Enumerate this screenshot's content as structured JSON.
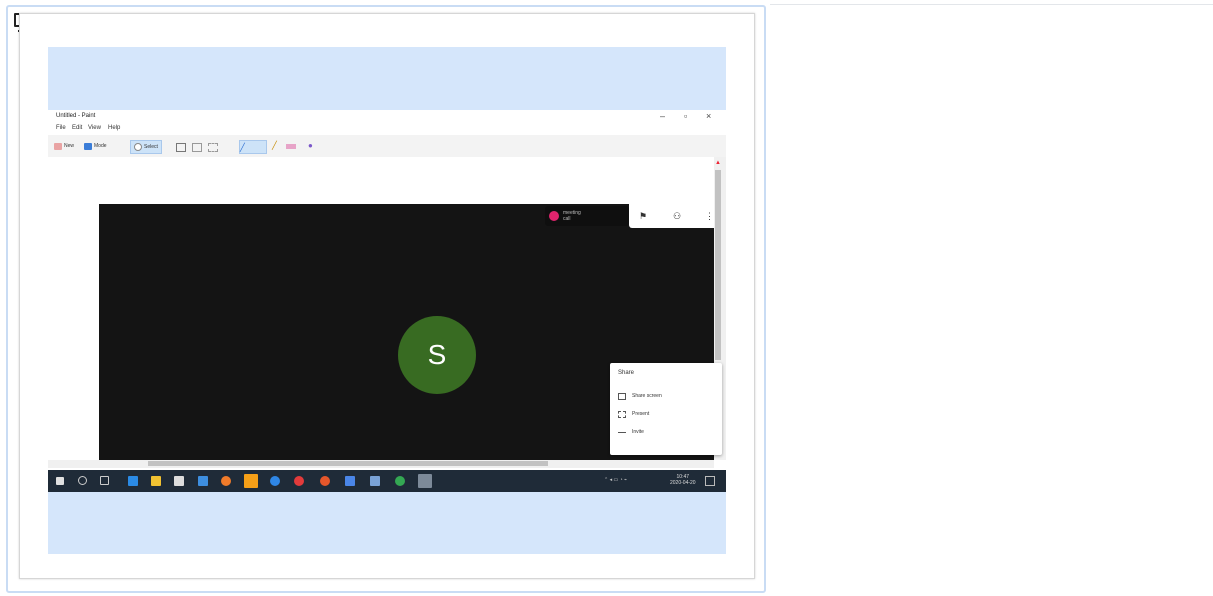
{
  "colors": {
    "accent_border": "#c9dcf4",
    "panel_bg": "#d5e6fb",
    "avatar_bg": "#386b22",
    "taskbar_bg": "#1f2b38"
  },
  "attachment_icon": "monitor-icon",
  "paint": {
    "title": "Untitled - Paint",
    "menu": [
      "File",
      "Edit",
      "View",
      "Help"
    ],
    "toolbar": {
      "new": "New",
      "mode": "Mode",
      "select": "Select"
    }
  },
  "call": {
    "avatar_letter": "S",
    "brand_line1": "meeting",
    "brand_line2": "call",
    "popup": {
      "title": "Share",
      "items": [
        "Share screen",
        "Present",
        "Invite"
      ]
    }
  },
  "taskbar": {
    "time": "10:47",
    "date": "2020-04-20",
    "icons": [
      "start-icon",
      "search-icon",
      "task-view-icon",
      "edge-icon",
      "files-icon",
      "store-icon",
      "mail-icon",
      "firefox-icon",
      "paint-icon",
      "chrome-icon",
      "opera-icon",
      "office-icon",
      "app-icon",
      "app2-icon",
      "app3-icon",
      "app4-icon"
    ]
  }
}
